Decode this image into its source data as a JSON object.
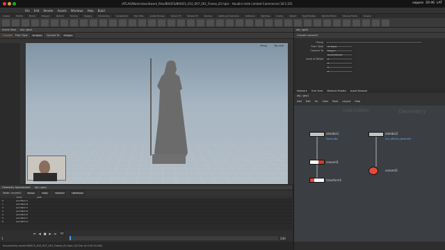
{
  "window": {
    "title": "/ATLAS/Work/xdavid/work_files/BASICS/BASICS_010_007_001_Freeze_02.hiplc - Houdini Indie Limited-Commercial 18.5.351",
    "clock": "20:46",
    "user": "xappos",
    "indicator": "LAT"
  },
  "menu": [
    "File",
    "Edit",
    "Render",
    "Assets",
    "Windows",
    "Help",
    "Build"
  ],
  "pane_tabs": [
    "Create",
    "Modify",
    "Model",
    "Polygon",
    "Deform",
    "Texture",
    "Rigging",
    "Characters",
    "Constraints",
    "Hair Utils",
    "Guide Process",
    "Terrain FX",
    "Simple FX",
    "Volume"
  ],
  "right_pane_tabs": [
    "Lights and Cameras",
    "Collisions",
    "Particles",
    "Grains",
    "Vellum",
    "Rigid Bodies",
    "Particle Fluids",
    "Viscous Fluids",
    "Oceans",
    "Fluid Containers",
    "Populate Containers"
  ],
  "viewport": {
    "tab": "Scene View",
    "path": "obj / geo1",
    "convert_label": "Convert",
    "from_type": "From Type",
    "from_value": "All Types",
    "convert_to": "Convert To",
    "convert_to_value": "Polygon",
    "persp": "Persp",
    "cam": "No cam"
  },
  "params": {
    "node_title": "Convert  convert1",
    "group_label": "Group",
    "from_type": "All Types",
    "convert_to": "Polygon",
    "conn_type": "Quadrilaterals",
    "lod_label": "Level of Detail",
    "lod_value": "0",
    "u_value": "0",
    "v_value": "0",
    "trim_value": "0"
  },
  "network": {
    "tabs": [
      "Network",
      "Tree View",
      "Material Palette",
      "Asset Browser"
    ],
    "path": "obj / geo1",
    "menu": [
      "Add",
      "Edit",
      "Go",
      "View",
      "Tools",
      "Layout",
      "Help"
    ],
    "watermark_left": "Indie Edition",
    "watermark_right": "Geometry",
    "nodes": [
      {
        "name": "alembic1",
        "sub": "horse.abc"
      },
      {
        "name": "alembic2",
        "sub": "scn_athena_pose.abc"
      },
      {
        "name": "convert1",
        "sub": ""
      },
      {
        "name": "convert2",
        "sub": ""
      },
      {
        "name": "transform1",
        "sub": ""
      }
    ]
  },
  "spreadsheet": {
    "tab": "Geometry Spreadsheet",
    "path": "obj / geo1",
    "node": "Node: convert1",
    "group": "Group",
    "view": "View",
    "intrinsic": "Intrinsic",
    "attributes": "Attributes",
    "header": [
      "",
      "name",
      "path"
    ],
    "rows": [
      "0",
      "1",
      "2",
      "3",
      "4",
      "5",
      "6"
    ],
    "cells": [
      "/ecc/Tank A",
      "/ecc/Tank B",
      "/ecc/Tank C",
      "/ecc/Tank D",
      "/ecc/Tank E",
      "/ecc/Tank F",
      "/ecc/Tank G"
    ]
  },
  "timeline": {
    "frame": "1",
    "start": "1",
    "end": "240",
    "end2": "240",
    "ticks": [
      "24",
      "48",
      "72",
      "96",
      "120",
      "144",
      "168",
      "192",
      "216",
      "240"
    ]
  },
  "status": {
    "message": "Successfully saved BASICS_010_007_001_Freeze_02.hiplc (02 Dec at  4:20:04 AM)",
    "keys_label": "0 keys, 0/0 channels",
    "key_all": "Key All Channels",
    "auto_update": "Auto Update"
  }
}
